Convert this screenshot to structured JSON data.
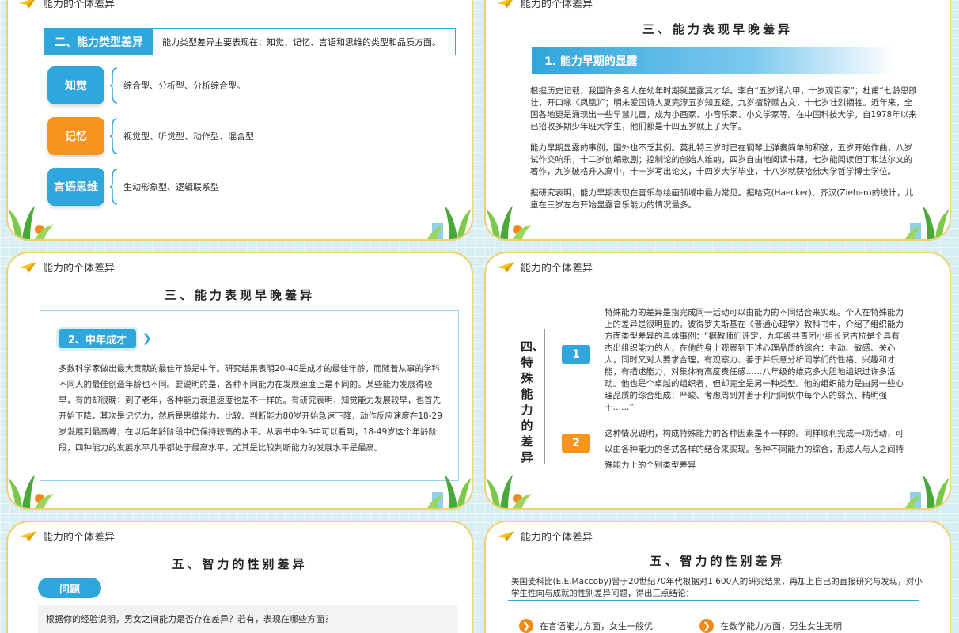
{
  "header_label": "能力的个体差异",
  "colors": {
    "blue": "#2fa6dc",
    "orange": "#f7941d",
    "border": "#f0d070"
  },
  "slide1": {
    "banner_tag": "二、能力类型差异",
    "banner_desc": "能力类型差异主要表现在：知觉、记忆、言语和思维的类型和品质方面。",
    "rows": [
      {
        "label": "知觉",
        "text": "综合型、分析型、分析综合型。",
        "color": "#2fa6dc"
      },
      {
        "label": "记忆",
        "text": "视觉型、听觉型、动作型、混合型",
        "color": "#f7941d"
      },
      {
        "label": "言语思维",
        "text": "生动形象型、逻辑联系型",
        "color": "#2fa6dc"
      }
    ]
  },
  "slide2": {
    "title": "三、能力表现早晚差异",
    "banner": "1. 能力早期的显露",
    "p1": "根据历史记载，我国许多名人在幼年时期就显露其才华。李白“五岁诵六甲，十岁观百家”；杜甫“七龄思即壮，开口咏《凤凰》”；明末爱国诗人夏完淳五岁知五经，九岁擅辞赋古文，十七岁壮烈牺牲。近年来，全国各地更是涌现出一些早慧儿童，成为小画家、小音乐家、小文学家等。在中国科技大学，自1978年以来已招收多期少年班大学生，他们都是十四五岁就上了大学。",
    "p2": "能力早期显露的事例，国外也不乏其例。莫扎特三岁时已在钢琴上弹奏简单的和弦，五岁开始作曲，八岁试作交响乐，十二岁创编歌剧；控制论的创始人维纳，四岁自由地阅读书籍，七岁能阅读但丁和达尔文的著作，九岁破格升入高中，十一岁写出论文，十四岁大学毕业，十八岁就获哈佛大学哲学博士学位。",
    "p3": "据研究表明，能力早期表现在音乐与绘画领域中最为常见。据哈克(Haecker)、齐汉(Ziehen)的统计，儿童在三岁左右开始显露音乐能力的情况最多。"
  },
  "slide3": {
    "title": "三、能力表现早晚差异",
    "badge": "2、中年成才",
    "arrow": "❯",
    "body": "多数科学家做出最大贡献的最佳年龄是中年。研究结果表明20-40是成才的最佳年龄，而随着从事的学科不同人的最佳创造年龄也不同。要说明的是，各种不同能力在发展速度上是不同的。某些能力发展得较早，有的却很晚；到了老年，各种能力衰退速度也是不一样的。有研究表明，知觉能力发展较早，也首先开始下降，其次是记忆力，然后是思维能力。比较、判断能力80岁开始急速下降，动作反应速度在18-29岁发展到最高峰，在以后年龄阶段中仍保持较高的水平。从表书中9-5中可以看到，18-49岁这个年龄阶段，四种能力的发展水平几乎都处于最高水平，尤其是比较判断能力的发展水平是最高。"
  },
  "slide4": {
    "vertical_title": "四、特殊能力的差异",
    "num1": "1",
    "num2": "2",
    "body1": "特殊能力的差异是指完成同一活动可以由能力的不同结合来实现。个人在特殊能力上的差异是很明显的。彼得罗夫斯基在《普通心理学》教科书中，介绍了组织能力方面类型差异的具体事例：“据教师们评定，九年级共青团小组长尼古拉是个具有杰出组织能力的人，在他的身上观察到下述心理品质的综合：主动、敏感、关心人，同时又对人要求合理，有观察力、善于并乐意分析同学们的性格、兴趣和才能，有描述能力，对集体有高度责任感……八年级的维克多大胆地组织过许多活动。他也是个卓越的组织者，但却完全是另一种类型。他的组织能力是由另一些心理品质的综合组成：严峻、考虑周到并善于利用同伙中每个人的弱点、精明强干……”",
    "body2": "这种情况说明，构成特殊能力的各种因素是不一样的。同样顺利完成一项活动，可以由各种能力的各式各样的结合来实现。各种不同能力的综合，形成人与人之间特殊能力上的个别类型差异"
  },
  "slide5": {
    "title": "五、智力的性别差异",
    "pill": "问题",
    "question": "根据你的经验说明，男女之间能力是否存在差异？若有，表现在哪些方面？"
  },
  "slide6": {
    "title": "五、智力的性别差异",
    "body": "美国麦科比(E.E.Maccoby)曾于20世纪70年代根据对1 600人的研究结果，再加上自己的直接研究与发现，对小学生性向与成就的性别差异问题，得出三点结论：",
    "item1": "在言语能力方面，女生一般优",
    "item2": "在数学能力方面，男生女生无明",
    "bullet": "❯"
  }
}
